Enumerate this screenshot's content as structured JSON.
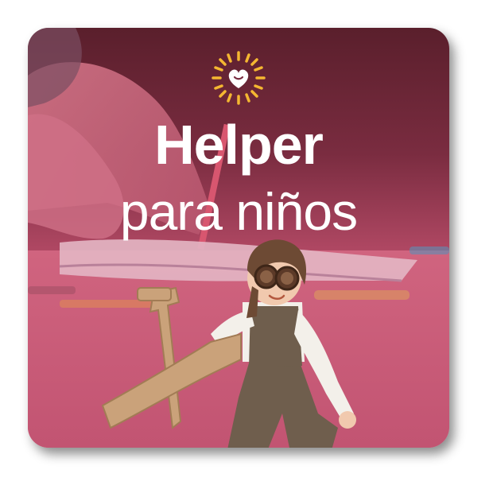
{
  "card": {
    "title_main": "Helper",
    "title_sub": "para niños",
    "accent_color": "#f5b731",
    "background_color": "#c95677"
  },
  "icons": {
    "logo": "sun-heart-icon"
  }
}
